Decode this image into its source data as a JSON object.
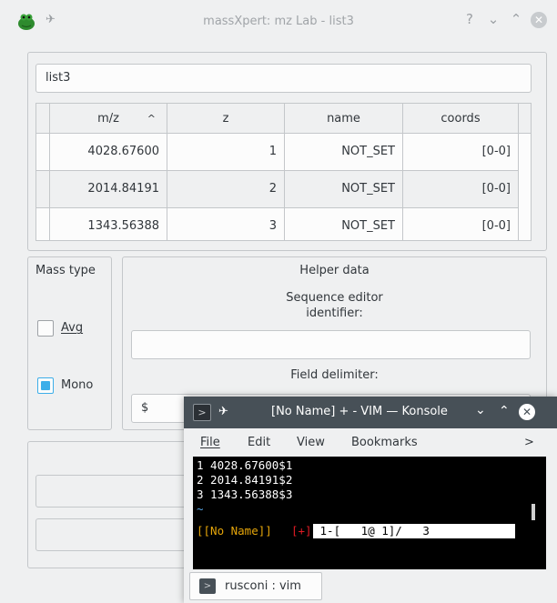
{
  "window": {
    "title": "massXpert: mz Lab - list3",
    "buttons": {
      "help": "?",
      "minimize": "⌄",
      "maximize": "⌃",
      "close": "✕"
    }
  },
  "list_name": "list3",
  "table": {
    "columns": [
      "m/z",
      "z",
      "name",
      "coords"
    ],
    "sort_indicator": "^",
    "rows": [
      {
        "mz": "4028.67600",
        "z": "1",
        "name": "NOT_SET",
        "coords": "[0-0]"
      },
      {
        "mz": "2014.84191",
        "z": "2",
        "name": "NOT_SET",
        "coords": "[0-0]"
      },
      {
        "mz": "1343.56388",
        "z": "3",
        "name": "NOT_SET",
        "coords": "[0-0]"
      }
    ]
  },
  "mass_type": {
    "title": "Mass type",
    "avg_label": "Avg",
    "mono_label": "Mono",
    "avg_checked": false,
    "mono_checked": true
  },
  "helper": {
    "title": "Helper data",
    "seq_label_line1": "Sequence editor",
    "seq_label_line2": "identifier:",
    "seq_value": "",
    "delim_label": "Field delimiter:",
    "delim_value": "$"
  },
  "konsole": {
    "title": "[No Name] + - VIM — Konsole",
    "menu": [
      "File",
      "Edit",
      "View",
      "Bookmarks"
    ],
    "menu_more": ">",
    "lines": [
      "1 4028.67600$1",
      "2 2014.84191$2",
      "3 1343.56388$3",
      "~"
    ],
    "status_name": "[[No Name]]",
    "status_mod": "[+]",
    "status_pos": " 1-[   1@ 1]/   3      ",
    "tab_label": "rusconi : vim"
  },
  "colors": {
    "accent": "#3daee9",
    "konsole_title": "#475057",
    "vim_status_name": "#e5a50a",
    "vim_status_mod": "#e01b24"
  }
}
